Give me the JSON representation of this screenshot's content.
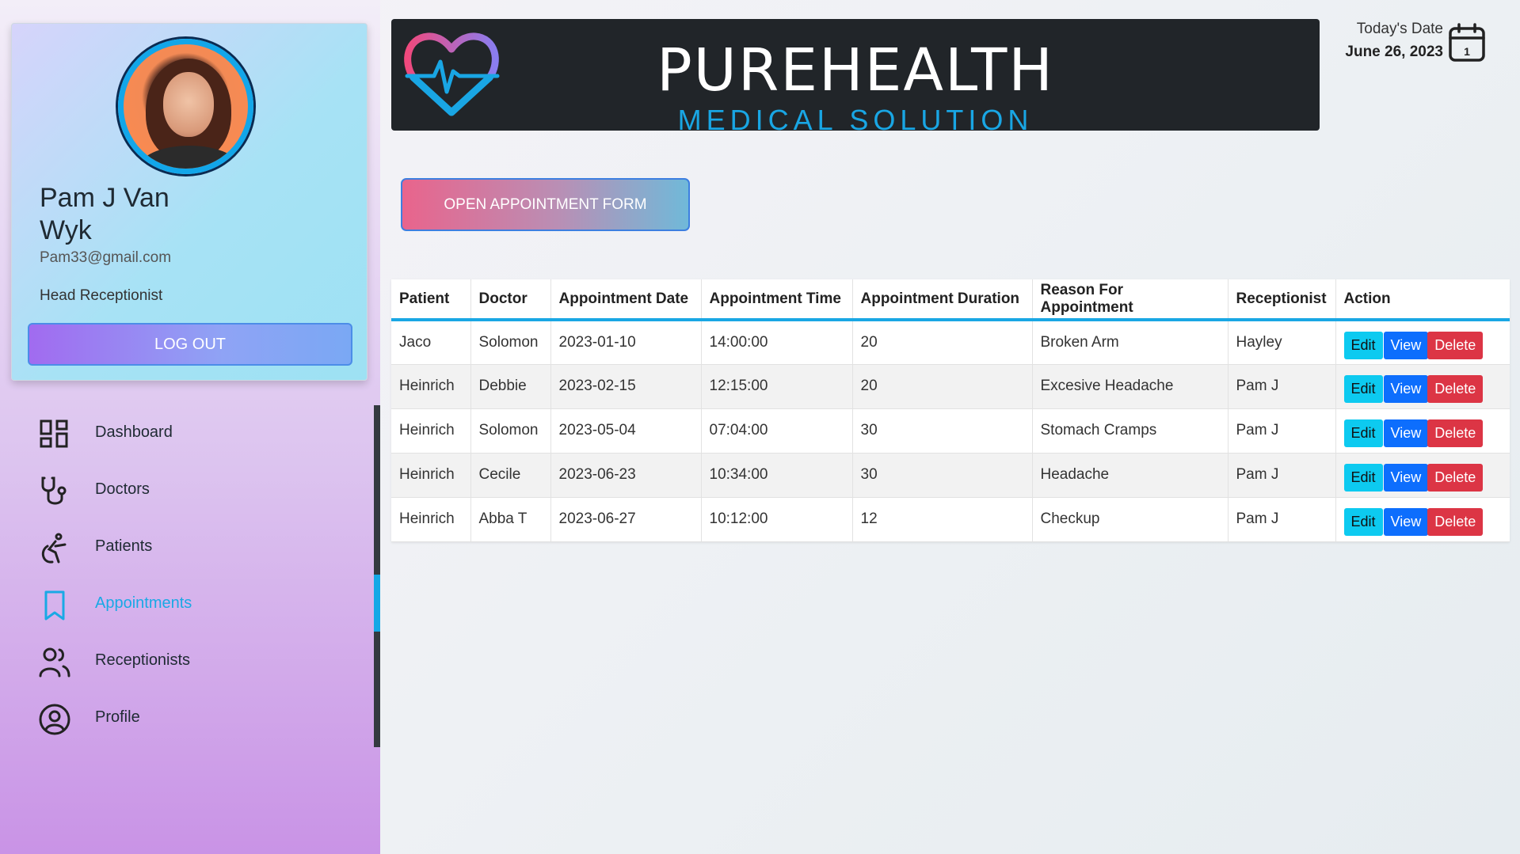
{
  "user": {
    "name": "Pam J Van Wyk",
    "email": "Pam33@gmail.com",
    "role": "Head Receptionist",
    "logout_label": "LOG OUT"
  },
  "nav": {
    "items": [
      {
        "label": "Dashboard",
        "icon": "dashboard-icon"
      },
      {
        "label": "Doctors",
        "icon": "stethoscope-icon"
      },
      {
        "label": "Patients",
        "icon": "wheelchair-icon"
      },
      {
        "label": "Appointments",
        "icon": "bookmark-icon"
      },
      {
        "label": "Receptionists",
        "icon": "users-icon"
      },
      {
        "label": "Profile",
        "icon": "user-circle-icon"
      }
    ],
    "active": "Appointments"
  },
  "header": {
    "title": "PUREHEALTH",
    "subtitle": "MEDICAL SOLUTION",
    "date_label": "Today's Date",
    "date_value": "June 26, 2023"
  },
  "open_form_label": "OPEN APPOINTMENT FORM",
  "table": {
    "columns": [
      "Patient",
      "Doctor",
      "Appointment Date",
      "Appointment Time",
      "Appointment Duration",
      "Reason For Appointment",
      "Receptionist",
      "Action"
    ],
    "rows": [
      [
        "Jaco",
        "Solomon",
        "2023-01-10",
        "14:00:00",
        "20",
        "Broken Arm",
        "Hayley"
      ],
      [
        "Heinrich",
        "Debbie",
        "2023-02-15",
        "12:15:00",
        "20",
        "Excesive Headache",
        "Pam J"
      ],
      [
        "Heinrich",
        "Solomon",
        "2023-05-04",
        "07:04:00",
        "30",
        "Stomach Cramps",
        "Pam J"
      ],
      [
        "Heinrich",
        "Cecile",
        "2023-06-23",
        "10:34:00",
        "30",
        "Headache",
        "Pam J"
      ],
      [
        "Heinrich",
        "Abba T",
        "2023-06-27",
        "10:12:00",
        "12",
        "Checkup",
        "Pam J"
      ]
    ],
    "actions": {
      "edit": "Edit",
      "view": "View",
      "delete": "Delete"
    }
  },
  "colors": {
    "accent": "#19a7e4",
    "banner_bg": "#212529",
    "edit": "#0dcaf0",
    "view": "#0d6efd",
    "delete": "#dc3545"
  }
}
